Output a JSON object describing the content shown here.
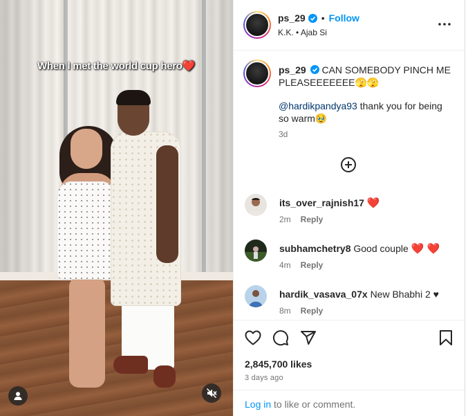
{
  "media": {
    "overlay_text": "When I met the world cup hero",
    "overlay_emoji": "❤️"
  },
  "header": {
    "username": "ps_29",
    "separator": "•",
    "follow_label": "Follow",
    "audio": "K.K. • Ajab Si"
  },
  "caption": {
    "username": "ps_29",
    "text": "CAN SOMEBODY PINCH ME PLEASEEEEEEE🫣🫣",
    "mention": "@hardikpandya93",
    "text2": " thank you for being so warm🥹",
    "time": "3d"
  },
  "comments": [
    {
      "username": "its_over_rajnish17",
      "text": "❤️",
      "time": "2m",
      "reply": "Reply"
    },
    {
      "username": "subhamchetry8",
      "text": "Good couple",
      "hearts": "❤️ ❤️",
      "time": "4m",
      "reply": "Reply"
    },
    {
      "username": "hardik_vasava_07x",
      "text": "New Bhabhi 2 ♥",
      "time": "8m",
      "reply": "Reply"
    }
  ],
  "engagement": {
    "likes": "2,845,700 likes",
    "posted": "3 days ago"
  },
  "footer": {
    "login_link": "Log in",
    "login_rest": " to like or comment."
  },
  "colors": {
    "accent": "#0095f6",
    "mention": "#00376b",
    "muted": "#737373",
    "heart": "#e0245e"
  }
}
